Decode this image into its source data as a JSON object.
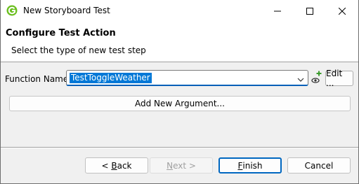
{
  "window": {
    "title": "New Storyboard Test"
  },
  "header": {
    "title": "Configure Test Action",
    "description": "Select the type of new test step"
  },
  "form": {
    "function_label": "Function Name:",
    "function_value": "TestToggleWeather",
    "edit_label": "Edit ...",
    "add_argument_label": "Add New Argument..."
  },
  "buttons": {
    "back_prefix": "< ",
    "back_mnemonic": "B",
    "back_rest": "ack",
    "next_mnemonic": "N",
    "next_rest": "ext >",
    "finish_mnemonic": "F",
    "finish_rest": "inish",
    "cancel_label": "Cancel"
  },
  "colors": {
    "accent": "#0078d7",
    "app_icon": "#6bbf1f"
  }
}
